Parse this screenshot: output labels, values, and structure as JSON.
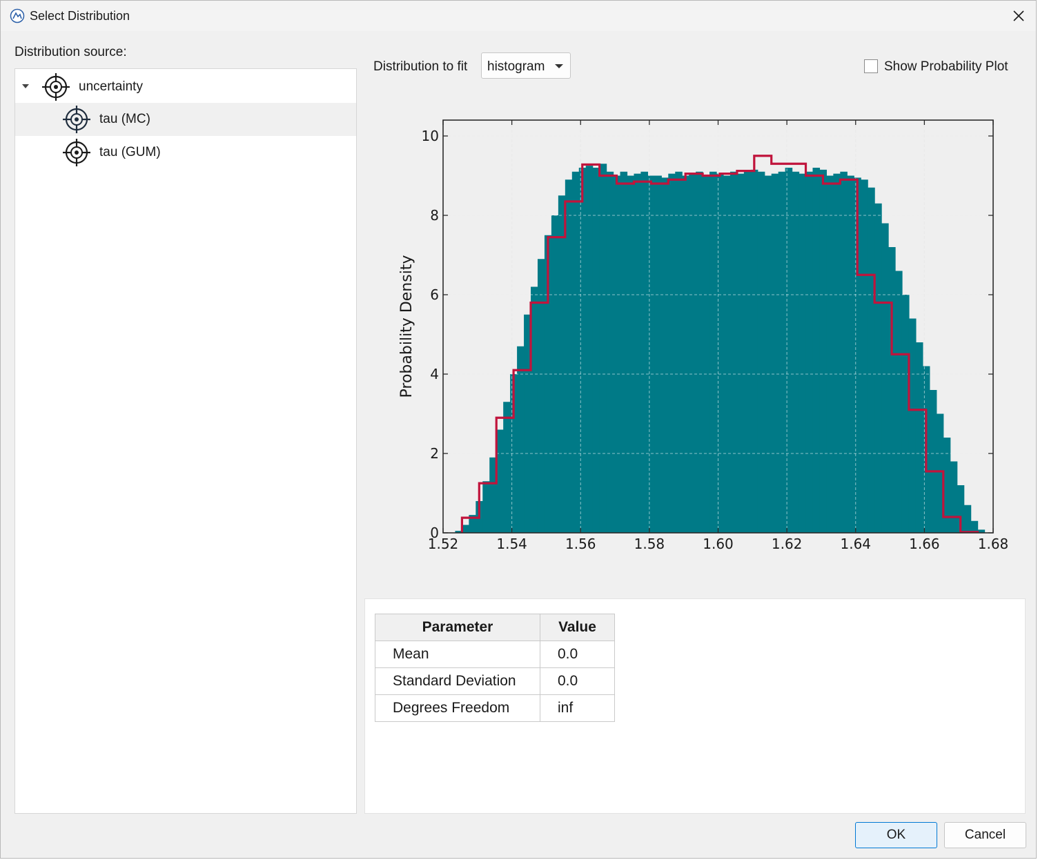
{
  "window": {
    "title": "Select Distribution",
    "close_icon": "close-icon",
    "app_icon": "app-logo-icon"
  },
  "source": {
    "label": "Distribution source:",
    "tree": [
      {
        "label": "uncertainty",
        "icon": "target-icon",
        "expanded": true,
        "selected": false
      },
      {
        "label": "tau (MC)",
        "icon": "target-icon",
        "selected": true
      },
      {
        "label": "tau (GUM)",
        "icon": "target-icon",
        "selected": false
      }
    ]
  },
  "fit": {
    "label": "Distribution to fit",
    "selected": "histogram",
    "dropdown_icon": "chevron-down-icon"
  },
  "probability_plot": {
    "label": "Show Probability Plot",
    "checked": false
  },
  "chart_data": {
    "type": "bar",
    "title": "",
    "xlabel": "",
    "ylabel": "Probability Density",
    "xlim": [
      1.52,
      1.68
    ],
    "ylim": [
      0,
      10.4
    ],
    "xticks": [
      "1.52",
      "1.54",
      "1.56",
      "1.58",
      "1.60",
      "1.62",
      "1.64",
      "1.66",
      "1.68"
    ],
    "yticks": [
      "0",
      "2",
      "4",
      "6",
      "8",
      "10"
    ],
    "grid": true,
    "series": [
      {
        "kind": "histogram-bars",
        "color": "#007a87",
        "x": [
          1.5245,
          1.5265,
          1.5285,
          1.5305,
          1.5325,
          1.5345,
          1.5365,
          1.5385,
          1.5405,
          1.5425,
          1.5445,
          1.5465,
          1.5485,
          1.5505,
          1.5525,
          1.5545,
          1.5565,
          1.5585,
          1.5605,
          1.5625,
          1.5645,
          1.5665,
          1.5685,
          1.5705,
          1.5725,
          1.5745,
          1.5765,
          1.5785,
          1.5805,
          1.5825,
          1.5845,
          1.5865,
          1.5885,
          1.5905,
          1.5925,
          1.5945,
          1.5965,
          1.5985,
          1.6005,
          1.6025,
          1.6045,
          1.6065,
          1.6085,
          1.6105,
          1.6125,
          1.6145,
          1.6165,
          1.6185,
          1.6205,
          1.6225,
          1.6245,
          1.6265,
          1.6285,
          1.6305,
          1.6325,
          1.6345,
          1.6365,
          1.6385,
          1.6405,
          1.6425,
          1.6445,
          1.6465,
          1.6485,
          1.6505,
          1.6525,
          1.6545,
          1.6565,
          1.6585,
          1.6605,
          1.6625,
          1.6645,
          1.6665,
          1.6685,
          1.6705,
          1.6725,
          1.6745,
          1.6765
        ],
        "values": [
          0.05,
          0.2,
          0.45,
          0.8,
          1.3,
          1.9,
          2.6,
          3.3,
          4.0,
          4.7,
          5.5,
          6.2,
          6.9,
          7.5,
          8.0,
          8.5,
          8.9,
          9.1,
          9.2,
          9.25,
          9.2,
          9.3,
          9.1,
          9.0,
          9.1,
          9.0,
          9.05,
          9.1,
          9.0,
          9.0,
          8.95,
          9.05,
          9.1,
          9.0,
          9.05,
          9.1,
          9.0,
          9.1,
          9.05,
          9.0,
          9.1,
          9.05,
          9.1,
          9.15,
          9.1,
          9.0,
          9.05,
          9.1,
          9.2,
          9.1,
          9.05,
          9.1,
          9.2,
          9.15,
          9.0,
          9.05,
          9.1,
          9.0,
          8.95,
          8.9,
          8.7,
          8.3,
          7.8,
          7.2,
          6.6,
          6.0,
          5.4,
          4.8,
          4.2,
          3.6,
          3.0,
          2.4,
          1.8,
          1.2,
          0.7,
          0.3,
          0.08
        ]
      },
      {
        "kind": "step-line",
        "color": "#c0143c",
        "x_edges": [
          1.5255,
          1.5305,
          1.5355,
          1.5405,
          1.5455,
          1.5505,
          1.5555,
          1.5605,
          1.5655,
          1.5705,
          1.5755,
          1.5805,
          1.5855,
          1.5905,
          1.5955,
          1.6005,
          1.6055,
          1.6105,
          1.6155,
          1.6205,
          1.6255,
          1.6305,
          1.6355,
          1.6405,
          1.6455,
          1.6505,
          1.6555,
          1.6605,
          1.6655,
          1.6705,
          1.6755
        ],
        "values": [
          0.38,
          1.25,
          2.9,
          4.1,
          5.8,
          7.45,
          8.35,
          9.28,
          9.0,
          8.8,
          8.85,
          8.8,
          8.9,
          9.05,
          9.0,
          9.05,
          9.12,
          9.5,
          9.3,
          9.3,
          9.0,
          8.8,
          8.9,
          6.5,
          5.8,
          4.5,
          3.1,
          1.55,
          0.4,
          0.02
        ]
      }
    ]
  },
  "parameters": {
    "headers": [
      "Parameter",
      "Value"
    ],
    "rows": [
      [
        "Mean",
        "0.0"
      ],
      [
        "Standard Deviation",
        "0.0"
      ],
      [
        "Degrees Freedom",
        "inf"
      ]
    ]
  },
  "buttons": {
    "ok": "OK",
    "cancel": "Cancel"
  }
}
